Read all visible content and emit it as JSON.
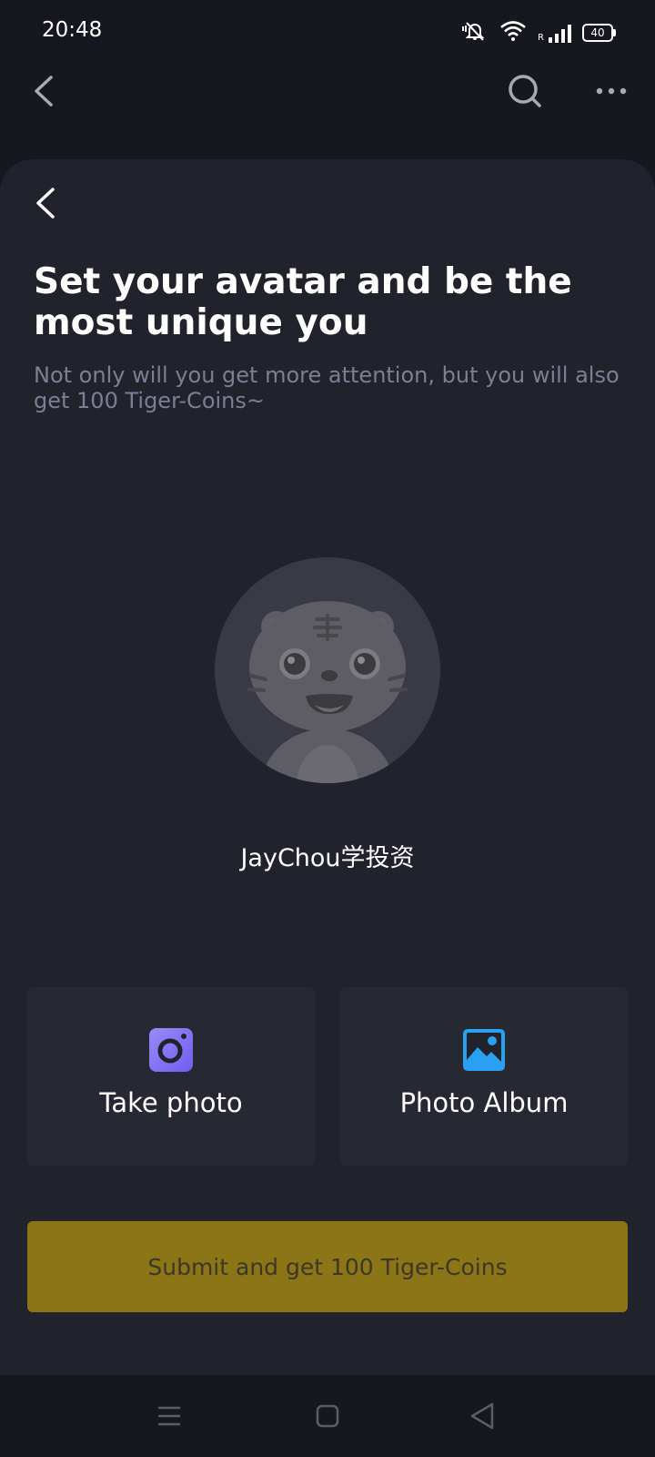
{
  "status_bar": {
    "time": "20:48",
    "battery_level": "40",
    "network_label": "R",
    "icons": [
      "mute-bell-icon",
      "wifi-icon",
      "signal-icon",
      "battery-icon"
    ]
  },
  "top_nav": {
    "icons": [
      "back-icon",
      "search-icon",
      "more-icon"
    ]
  },
  "sheet": {
    "title": "Set your avatar and be the most unique you",
    "subtitle": "Not only will you get more attention, but you will also get 100 Tiger-Coins~",
    "username": "JayChou学投资",
    "options": [
      {
        "label": "Take photo",
        "icon": "camera-icon",
        "color": "#8b7cf6"
      },
      {
        "label": "Photo Album",
        "icon": "image-icon",
        "color": "#2a9bf0"
      }
    ],
    "submit_label": "Submit and get 100 Tiger-Coins",
    "submit_color": "#8b7516"
  },
  "system_nav": {
    "icons": [
      "menu-icon",
      "home-icon",
      "back-triangle-icon"
    ]
  }
}
